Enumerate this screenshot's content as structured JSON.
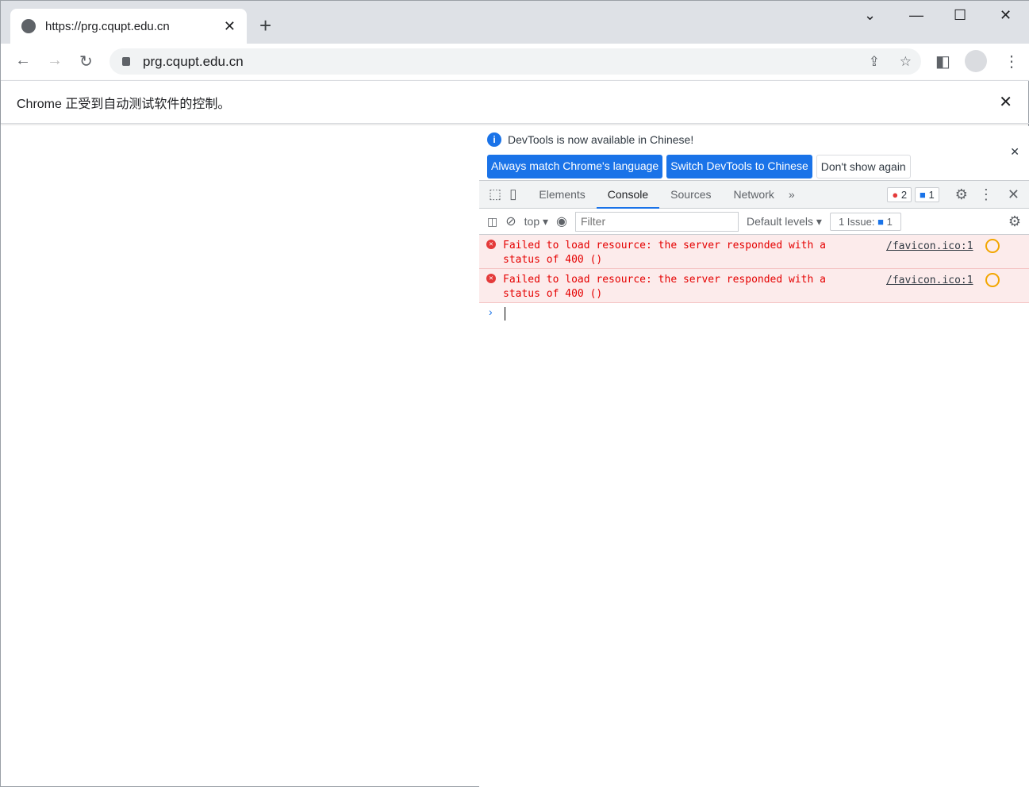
{
  "browser": {
    "tab_title": "https://prg.cqupt.edu.cn",
    "url": "prg.cqupt.edu.cn",
    "infobar": "Chrome 正受到自动测试软件的控制。"
  },
  "devtools": {
    "lang_msg": "DevTools is now available in Chinese!",
    "btn_match": "Always match Chrome's language",
    "btn_switch": "Switch DevTools to Chinese",
    "btn_dont": "Don't show again",
    "tabs": [
      "Elements",
      "Console",
      "Sources",
      "Network"
    ],
    "active_tab": "Console",
    "errors_count": "2",
    "messages_count": "1",
    "context": "top",
    "filter_placeholder": "Filter",
    "levels": "Default levels",
    "issues": "1 Issue:",
    "issues_count": "1",
    "messages": [
      {
        "text": "Failed to load resource: the server responded with a status of 400 ()",
        "source": "/favicon.ico:1"
      },
      {
        "text": "Failed to load resource: the server responded with a status of 400 ()",
        "source": "/favicon.ico:1"
      }
    ]
  }
}
